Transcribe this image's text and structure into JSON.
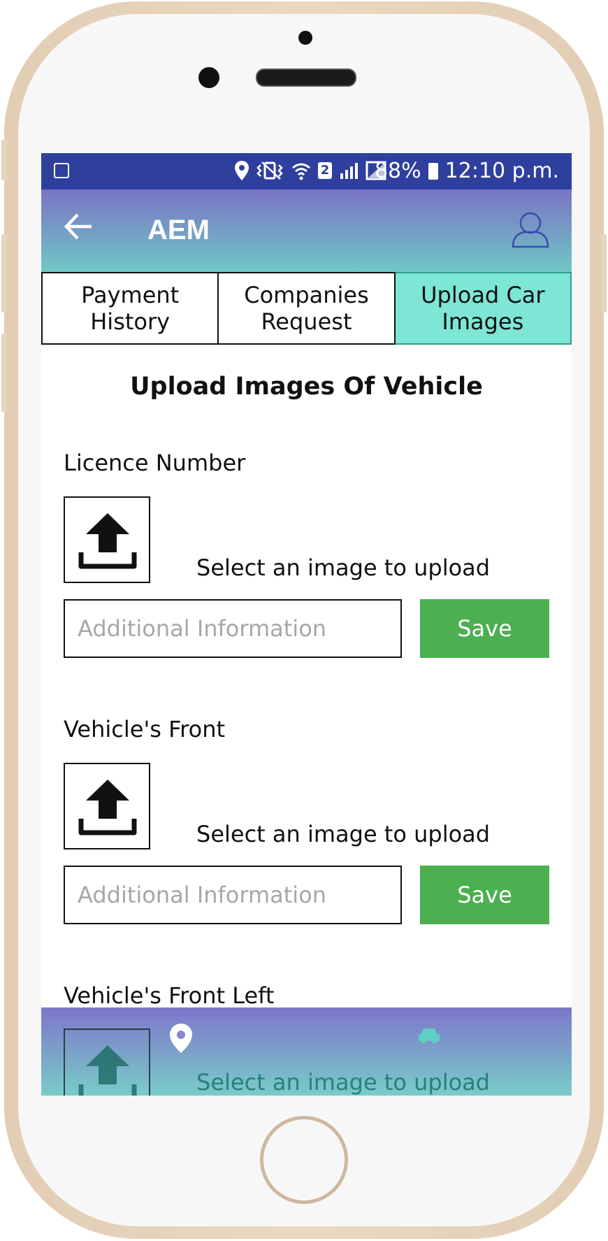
{
  "status_bar": {
    "battery": "88%",
    "time": "12:10 p.m.",
    "sim_slot": "2",
    "icons": [
      "image-icon",
      "location-icon",
      "vibrate-icon",
      "wifi-icon",
      "sim-icon",
      "signal-icon",
      "battery-icon"
    ]
  },
  "app_bar": {
    "title": "AEM",
    "back_icon": "arrow-left-icon",
    "profile_icon": "user-icon"
  },
  "tabs": [
    {
      "label": "Payment History",
      "active": false
    },
    {
      "label": "Companies Request",
      "active": false
    },
    {
      "label": "Upload Car Images",
      "active": true
    }
  ],
  "main": {
    "title": "Upload Images Of Vehicle",
    "sections": [
      {
        "label": "Licence Number",
        "upload_text": "Select an image to upload",
        "placeholder": "Additional Information",
        "save_label": "Save"
      },
      {
        "label": "Vehicle's Front",
        "upload_text": "Select an image to upload",
        "placeholder": "Additional Information",
        "save_label": "Save"
      },
      {
        "label": "Vehicle's Front Left",
        "upload_text": "Select an image to upload"
      }
    ]
  },
  "bottom_nav": {
    "items": [
      {
        "icon": "map-pin-icon"
      },
      {
        "icon": "car-icon"
      }
    ]
  },
  "colors": {
    "status_bar": "#2f3f9e",
    "app_bar_top": "#7a73c3",
    "app_bar_bottom": "#70c8c4",
    "active_tab": "#7de6d5",
    "save_button": "#4caf50"
  }
}
